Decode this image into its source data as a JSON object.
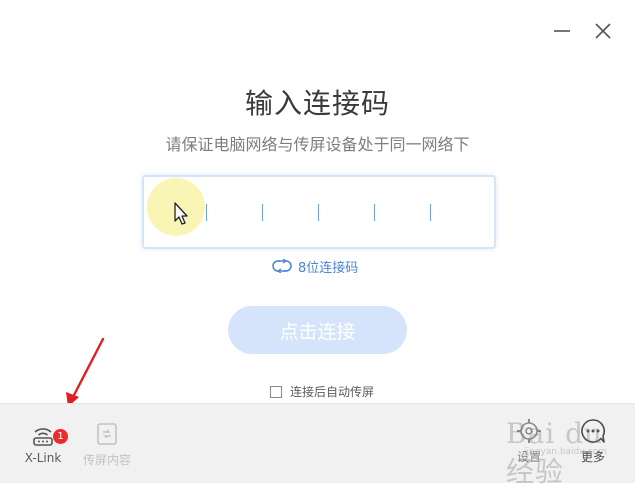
{
  "dialog": {
    "title": "输入连接码",
    "subtitle": "请保证电脑网络与传屏设备处于同一网络下",
    "code_input": {
      "value": "",
      "slots": 6
    },
    "mode_switch_label": "8位连接码",
    "connect_button_label": "点击连接",
    "auto_cast_label": "连接后自动传屏",
    "auto_cast_checked": false
  },
  "window_controls": {
    "minimize_icon": "minimize-icon",
    "close_icon": "close-icon"
  },
  "bottom_bar": {
    "xlink": {
      "label": "X-Link",
      "icon": "router-icon",
      "badge": "1"
    },
    "cast_content": {
      "label": "传屏内容",
      "icon": "screen-share-icon"
    },
    "settings": {
      "label": "设置",
      "icon": "gear-icon"
    },
    "more": {
      "label": "更多",
      "icon": "chat-dots-icon"
    }
  },
  "watermark": {
    "text": "Bai du 经验",
    "sub": "jingyan.baidu.com"
  },
  "colors": {
    "accent": "#4a83d8",
    "button_disabled": "#d5e4fb",
    "badge": "#ee2b2b",
    "annotation_arrow": "#e02020"
  }
}
